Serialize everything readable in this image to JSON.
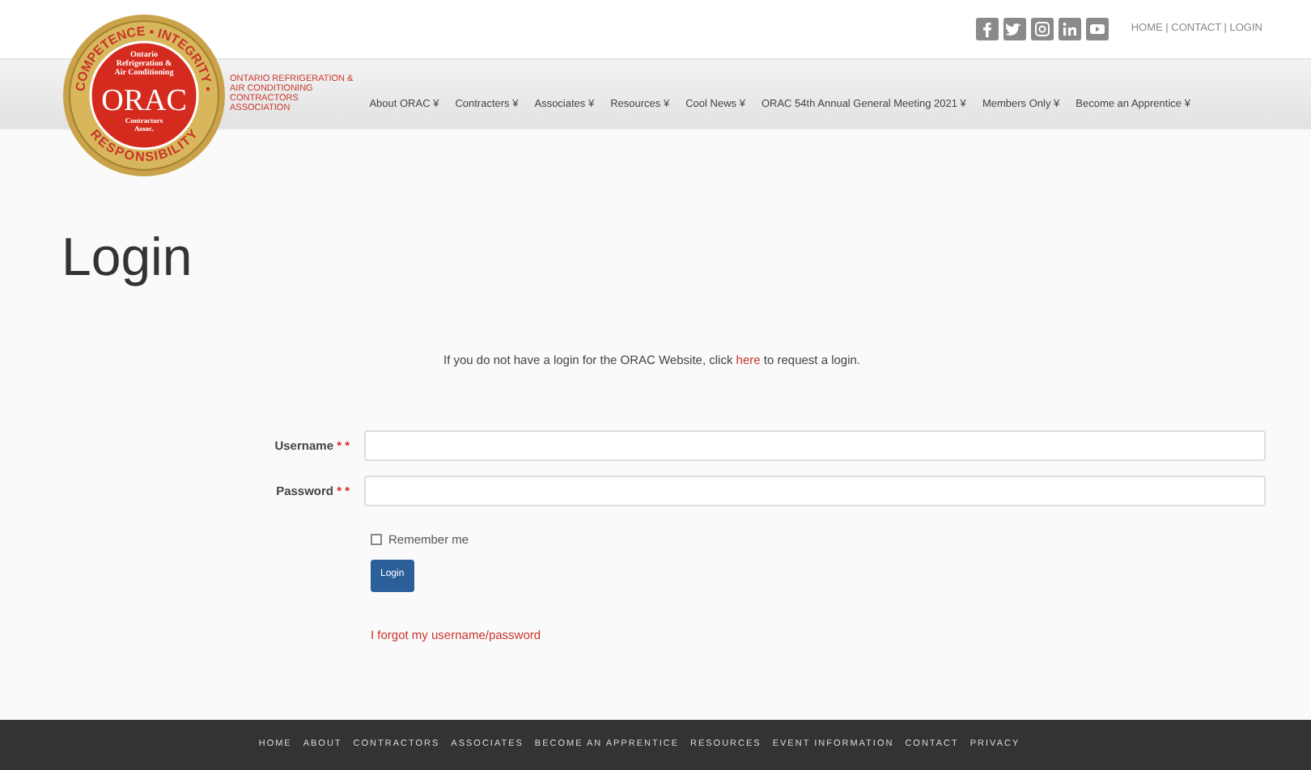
{
  "logo": {
    "arc_top": "COMPETENCE • INTEGRITY •",
    "arc_bottom": "RESPONSIBILITY",
    "lines_top": [
      "Ontario",
      "Refrigeration &",
      "Air Conditioning"
    ],
    "mark": "ORAC",
    "lines_bottom": [
      "Contractors",
      "Assoc."
    ]
  },
  "brand": [
    "ONTARIO REFRIGERATION &",
    "AIR CONDITIONING",
    "CONTRACTORS",
    "ASSOCIATION"
  ],
  "social": [
    {
      "kind": "facebook"
    },
    {
      "kind": "twitter"
    },
    {
      "kind": "instagram"
    },
    {
      "kind": "linkedin"
    },
    {
      "kind": "youtube"
    }
  ],
  "top_links": "HOME | CONTACT | LOGIN",
  "nav": [
    {
      "label": "About ORAC ¥"
    },
    {
      "label": "Contracters ¥"
    },
    {
      "label": "Associates ¥"
    },
    {
      "label": "Resources ¥"
    },
    {
      "label": "Cool News ¥"
    },
    {
      "label": "ORAC 54th Annual General Meeting 2021 ¥"
    },
    {
      "label": "Members Only ¥"
    },
    {
      "label": "Become an Apprentice ¥"
    }
  ],
  "heading": "Login",
  "info": {
    "before": "If you do not have a login for the ORAC Website, click ",
    "link": "here",
    "after": " to request a login."
  },
  "fields": [
    {
      "label": "Username",
      "required": "* *"
    },
    {
      "label": "Password",
      "required": "* *"
    }
  ],
  "remember": {
    "label": "Remember me",
    "checked": false
  },
  "login_button": "Login",
  "forgot": "I forgot my username/password",
  "footer": [
    "HOME",
    "ABOUT",
    "CONTRACTORS",
    "ASSOCIATES",
    "BECOME AN APPRENTICE",
    "RESOURCES",
    "EVENT INFORMATION",
    "CONTACT",
    "PRIVACY"
  ]
}
